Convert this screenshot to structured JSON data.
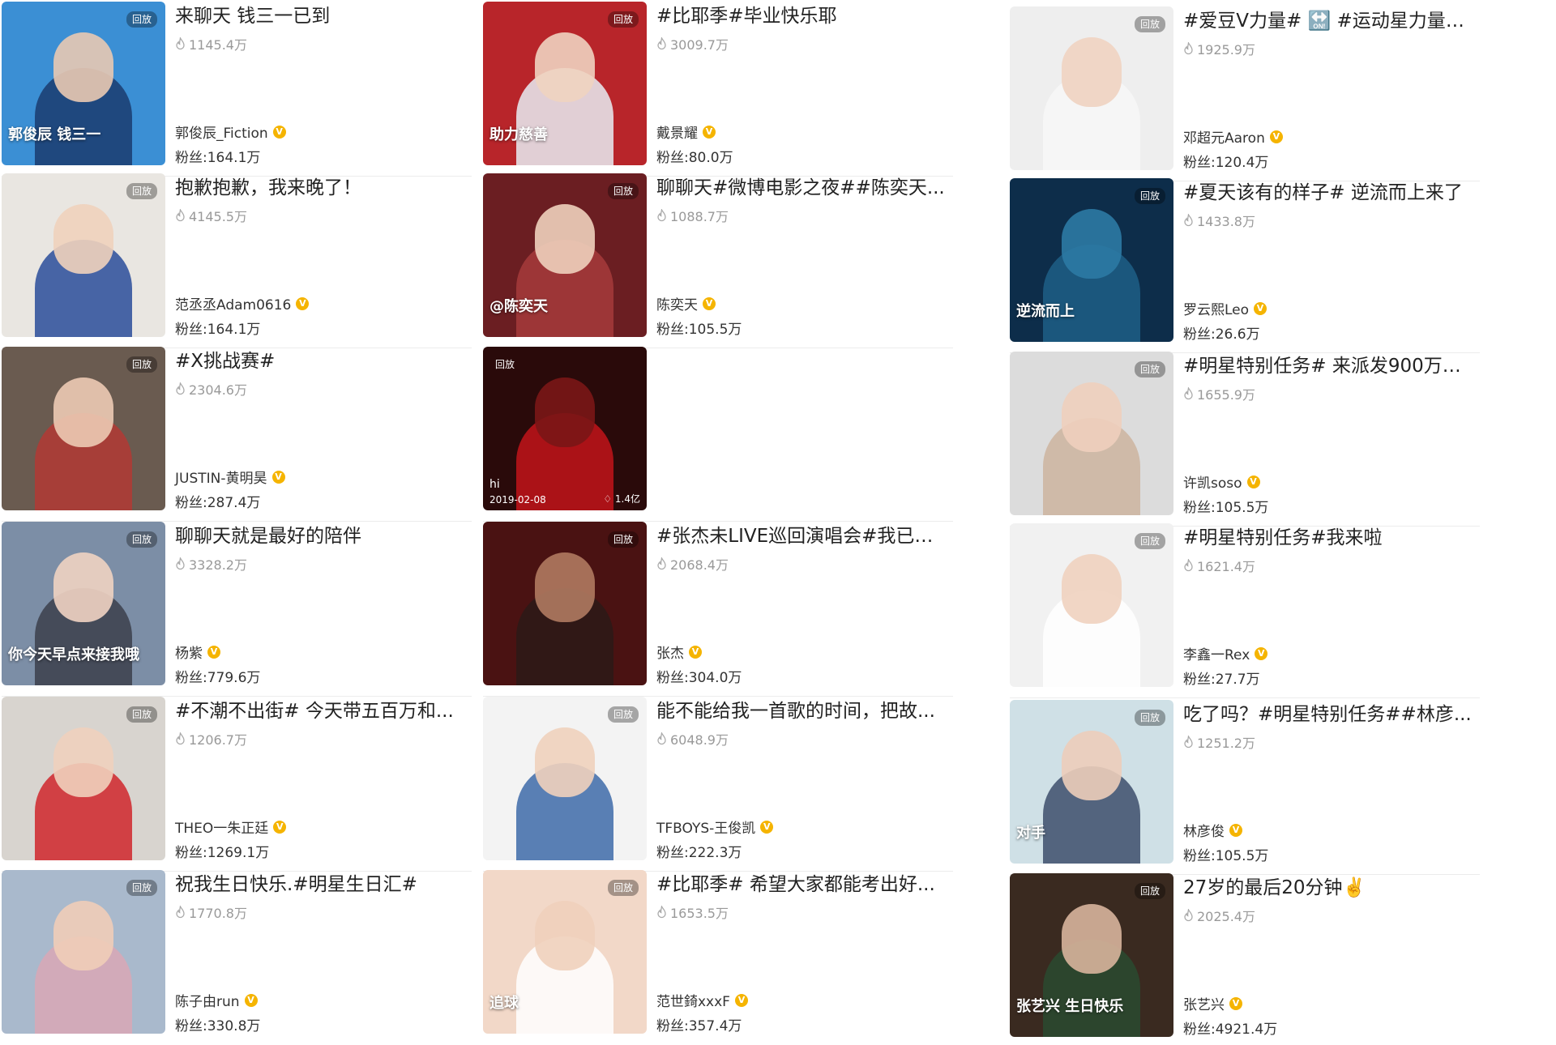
{
  "replay_label": "回放",
  "columns": [
    [
      {
        "title": "来聊天 钱三一已到",
        "views": "1145.4万",
        "author": "郭俊辰_Fiction",
        "fans": "粉丝:164.1万",
        "bg": "#3b8fd4",
        "fig": "#1b3c6e",
        "head": "#e9c9b2",
        "overlay": "郭俊辰 钱三一"
      },
      {
        "title": "抱歉抱歉，我来晚了！",
        "views": "4145.5万",
        "author": "范丞丞Adam0616",
        "fans": "粉丝:164.1万",
        "bg": "#e9e6e1",
        "fig": "#2a4c9a",
        "head": "#efd2bd",
        "overlay": ""
      },
      {
        "title": "#X挑战赛#",
        "views": "2304.6万",
        "author": "JUSTIN-黄明昊",
        "fans": "粉丝:287.4万",
        "bg": "#6a5b50",
        "fig": "#b23a34",
        "head": "#edcab4",
        "overlay": ""
      },
      {
        "title": "聊聊天就是最好的陪伴",
        "views": "3328.2万",
        "author": "杨紫",
        "fans": "粉丝:779.6万",
        "bg": "#7c8ea6",
        "fig": "#3c3f4b",
        "head": "#f0d3c2",
        "overlay": "你今天早点来接我哦"
      },
      {
        "title": "#不潮不出街# 今天带五百万和...",
        "views": "1206.7万",
        "author": "THEO一朱正廷",
        "fans": "粉丝:1269.1万",
        "bg": "#d8d4cf",
        "fig": "#d0262b",
        "head": "#efd0bc",
        "overlay": ""
      },
      {
        "title": "祝我生日快乐.#明星生日汇#",
        "views": "1770.8万",
        "author": "陈子由run",
        "fans": "粉丝:330.8万",
        "bg": "#a9b9cc",
        "fig": "#d9a7b5",
        "head": "#efcdb8",
        "overlay": ""
      }
    ],
    [
      {
        "title": "#比耶季#毕业快乐耶",
        "views": "3009.7万",
        "author": "戴景耀",
        "fans": "粉丝:80.0万",
        "bg": "#b8252a",
        "fig": "#e8edf3",
        "head": "#efd3c0",
        "overlay": "助力慈善"
      },
      {
        "title": "聊聊天#微博电影之夜##陈奕天...",
        "views": "1088.7万",
        "author": "陈奕天",
        "fans": "粉丝:105.5万",
        "bg": "#6b1e22",
        "fig": "#a63b3b",
        "head": "#f0d0bd",
        "overlay": "@陈奕天"
      },
      {
        "special": true,
        "bg": "#2a0a0a",
        "fig": "#c2141a",
        "head": "#7a1616",
        "hi": "hi",
        "date": "2019-02-08",
        "count": "1.4亿"
      },
      {
        "title": "#张杰未LIVE巡回演唱会#我已经...",
        "views": "2068.4万",
        "author": "张杰",
        "fans": "粉丝:304.0万",
        "bg": "#4a1212",
        "fig": "#2b1a18",
        "head": "#b07a60",
        "overlay": ""
      },
      {
        "title": "能不能给我一首歌的时间，把故...",
        "views": "6048.9万",
        "author": "TFBOYS-王俊凯",
        "fans": "粉丝:222.3万",
        "bg": "#f3f3f3",
        "fig": "#3d6aa8",
        "head": "#efd1bd",
        "overlay": ""
      },
      {
        "title": "#比耶季# 希望大家都能考出好...",
        "views": "1653.5万",
        "author": "范世錡xxxF",
        "fans": "粉丝:357.4万",
        "bg": "#f2d8c8",
        "fig": "#ffffff",
        "head": "#efd0bb",
        "overlay": "追球"
      }
    ],
    [
      {
        "title": "#爱豆V力量# 🔛 #运动星力量#...",
        "views": "1925.9万",
        "author": "邓超元Aaron",
        "fans": "粉丝:120.4万",
        "bg": "#eeeeee",
        "fig": "#f7f7f7",
        "head": "#efd3c1",
        "overlay": ""
      },
      {
        "title": "#夏天该有的样子# 逆流而上来了",
        "views": "1433.8万",
        "author": "罗云熙Leo",
        "fans": "粉丝:26.6万",
        "bg": "#0d2d4a",
        "fig": "#1f5f86",
        "head": "#2c7aa4",
        "overlay": "逆流而上"
      },
      {
        "title": "#明星特别任务# 来派发900万福...",
        "views": "1655.9万",
        "author": "许凯soso",
        "fans": "粉丝:105.5万",
        "bg": "#dcdcdc",
        "fig": "#cdb49f",
        "head": "#eecfbd",
        "overlay": ""
      },
      {
        "title": "#明星特别任务#我来啦",
        "views": "1621.4万",
        "author": "李鑫一Rex",
        "fans": "粉丝:27.7万",
        "bg": "#f1f1f1",
        "fig": "#ffffff",
        "head": "#efd1bf",
        "overlay": ""
      },
      {
        "title": "吃了吗？#明星特别任务##林彦...",
        "views": "1251.2万",
        "author": "林彦俊",
        "fans": "粉丝:105.5万",
        "bg": "#cfe0e6",
        "fig": "#3d4d6b",
        "head": "#eccdba",
        "overlay": "对手"
      },
      {
        "title": "27岁的最后20分钟✌️",
        "views": "2025.4万",
        "author": "张艺兴",
        "fans": "粉丝:4921.4万",
        "bg": "#3a2a20",
        "fig": "#2a4a30",
        "head": "#d8b49c",
        "overlay": "张艺兴 生日快乐"
      }
    ]
  ]
}
